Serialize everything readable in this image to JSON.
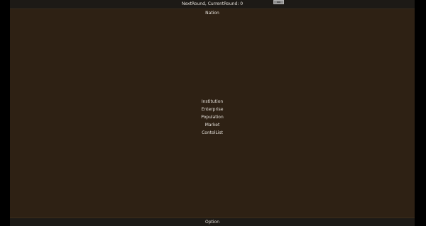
{
  "topbar": {
    "round_text": "NextRound, CurrentRound: 0"
  },
  "header": {
    "nation_label": "Nation"
  },
  "menu": {
    "items": [
      {
        "label": "Institution"
      },
      {
        "label": "Enterprise"
      },
      {
        "label": "Population"
      },
      {
        "label": "Market"
      },
      {
        "label": "ContolList"
      }
    ]
  },
  "footer": {
    "option_label": "Option"
  },
  "colors": {
    "background": "#2e2114",
    "bar": "#1d1a16",
    "outer": "#000000",
    "text": "#e6e2dc"
  }
}
